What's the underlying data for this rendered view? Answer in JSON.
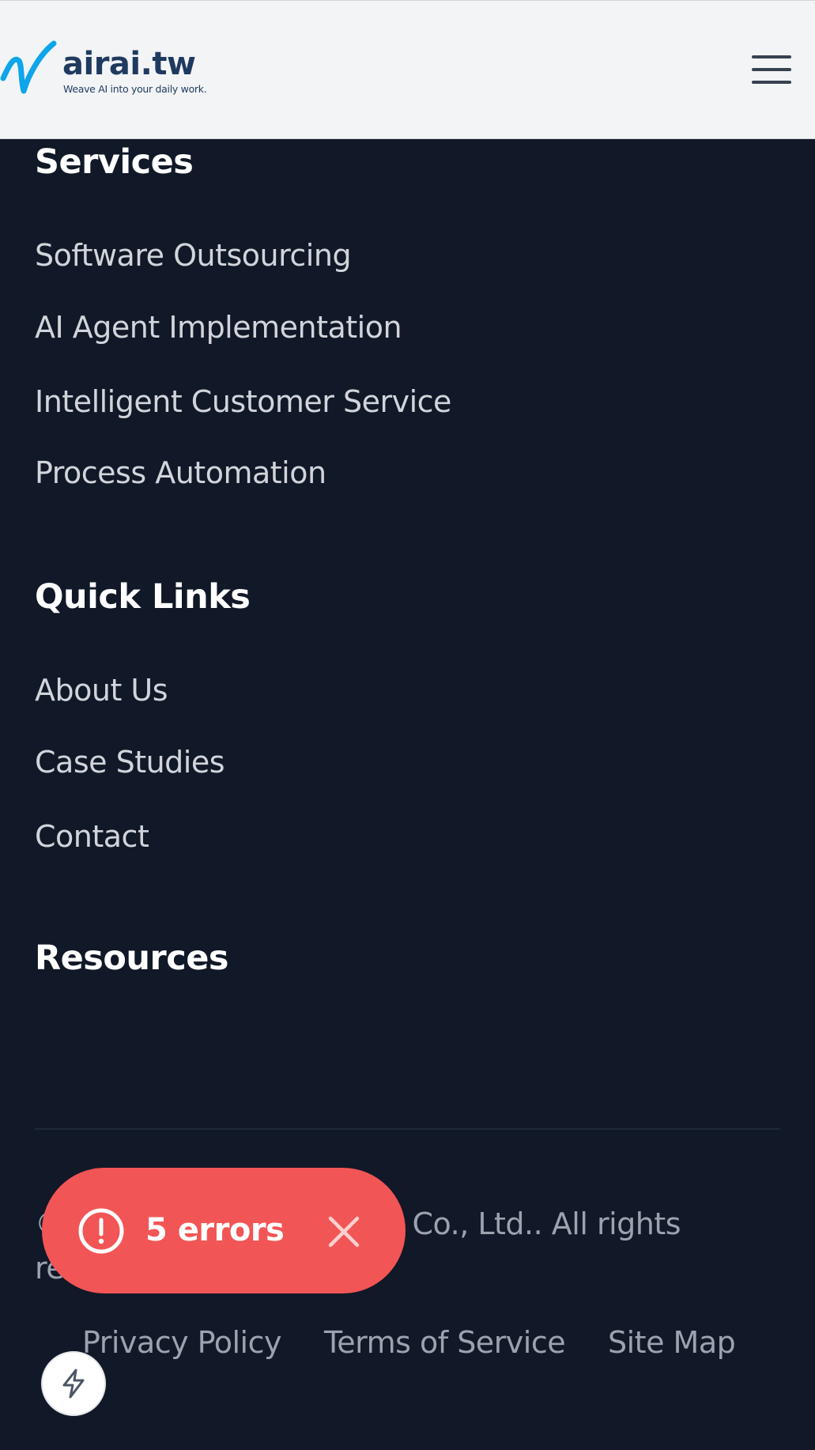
{
  "header": {
    "logo_name": "airai.tw",
    "logo_tagline": "Weave AI into your daily work.",
    "menu_icon": "hamburger-menu-icon",
    "brand_color": "#1e3a5f",
    "logo_accent_color": "#0ea5e9"
  },
  "services": {
    "heading": "Services",
    "links": [
      "Software Outsourcing",
      "AI Agent Implementation",
      "Intelligent Customer Service",
      "Process Automation"
    ]
  },
  "quick_links": {
    "heading": "Quick Links",
    "links": [
      "About Us",
      "Case Studies",
      "Contact"
    ]
  },
  "resources": {
    "heading": "Resources"
  },
  "footer": {
    "copyright_line1_start": "©",
    "copyright_line1_end": "Co., Ltd.. All rights",
    "copyright_line2": "re",
    "legal_links": [
      "Privacy Policy",
      "Terms of Service",
      "Site Map"
    ]
  },
  "error_toast": {
    "label": "5 errors",
    "icon": "exclamation-circle-icon",
    "close_icon": "close-icon",
    "color": "#f25555"
  },
  "fab": {
    "icon": "lightning-bolt-icon"
  },
  "colors": {
    "page_background": "#111827",
    "header_background": "#f3f4f6",
    "heading_text": "#ffffff",
    "link_text": "#d1d5db",
    "muted_text": "#9ca3af"
  }
}
